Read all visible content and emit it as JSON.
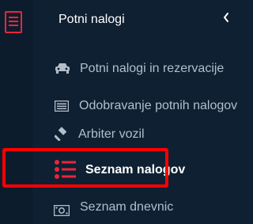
{
  "sidebar": {
    "title": "Potni nalogi",
    "icons": {
      "menu": "menu-list-icon",
      "collapse": "chevron-left-icon"
    },
    "items": [
      {
        "label": "Potni nalogi in rezervacije",
        "icon": "car-icon",
        "active": false
      },
      {
        "label": "Odobravanje potnih nalogov",
        "icon": "card-icon",
        "active": false
      },
      {
        "label": "Arbiter vozil",
        "icon": "gavel-icon",
        "active": false
      },
      {
        "label": "Seznam nalogov",
        "icon": "list-icon",
        "active": true
      },
      {
        "label": "Seznam dnevnic",
        "icon": "money-icon",
        "active": false
      }
    ]
  },
  "colors": {
    "background": "#0f2033",
    "rail": "#0d1c2d",
    "text_muted": "#b3becb",
    "text_active": "#ffffff",
    "accent_red": "#e8263b",
    "highlight": "#ff0000"
  }
}
